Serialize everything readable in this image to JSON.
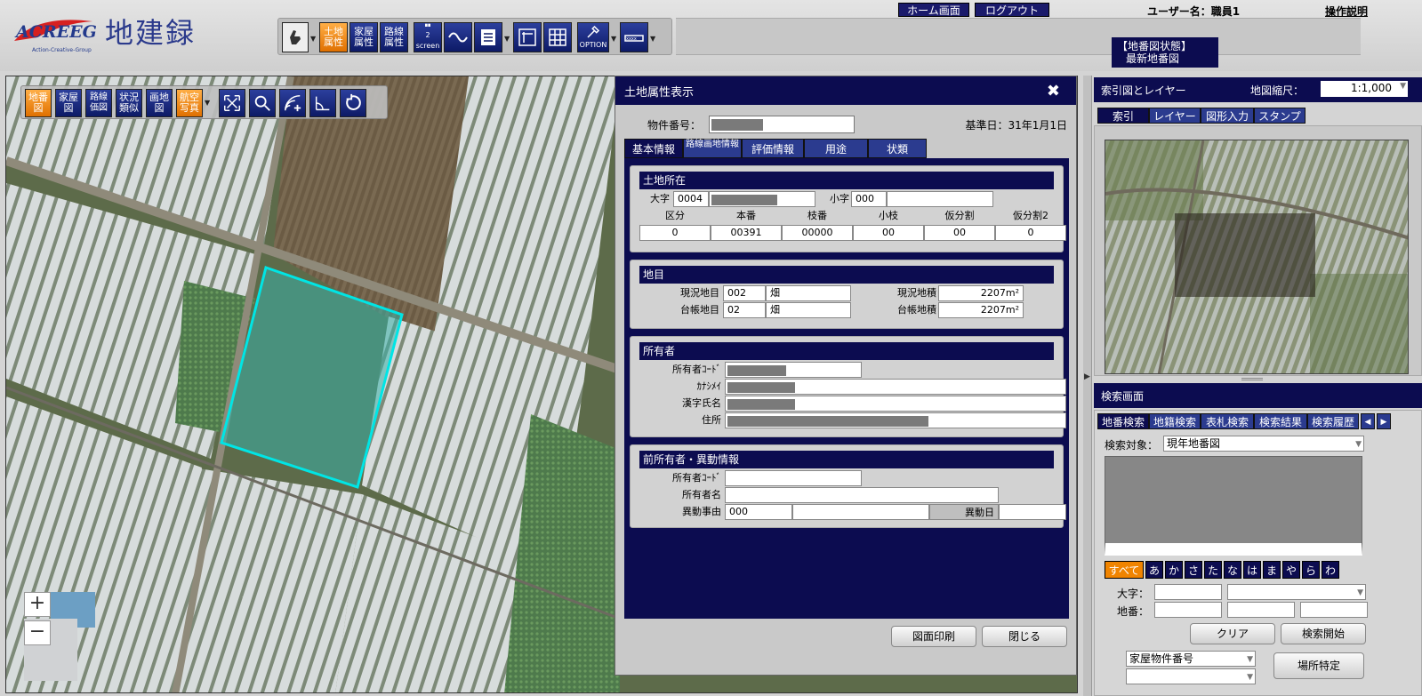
{
  "header": {
    "logo_text": "ACREEG",
    "logo_subtitle": "Action-Creative-Group",
    "app_title": "地建録",
    "home_button": "ホーム画面",
    "logout_button": "ログアウト",
    "user_label": "ユーザー名：職員1",
    "help_link": "操作説明",
    "map_status_title": "【地番図状態】",
    "map_status_value": "最新地番図"
  },
  "toolbar": {
    "buttons": [
      "土地属性",
      "家屋属性",
      "路線属性",
      "2 screen",
      "OPTION"
    ]
  },
  "map_toolbar": {
    "buttons": [
      "地番図",
      "家屋図",
      "路線価図",
      "状況類似",
      "画地図",
      "航空写真"
    ]
  },
  "zoom": {
    "in": "+",
    "out": "−"
  },
  "dialog": {
    "title": "土地属性表示",
    "close": "✖",
    "property_number_label": "物件番号：",
    "base_date": "基準日：31年1月1日",
    "tabs": [
      "基本情報",
      "路線画地情報",
      "評価情報",
      "用途",
      "状類"
    ],
    "location": {
      "header": "土地所在",
      "oaza_label": "大字",
      "oaza_code": "0004",
      "koaza_label": "小字",
      "koaza_code": "000",
      "columns": [
        "区分",
        "本番",
        "枝番",
        "小枝",
        "仮分割",
        "仮分割2"
      ],
      "values": [
        "0",
        "00391",
        "00000",
        "00",
        "00",
        "0"
      ]
    },
    "land_category": {
      "header": "地目",
      "current_label": "現況地目",
      "current_code": "002",
      "current_name": "畑",
      "ledger_label": "台帳地目",
      "ledger_code": "02",
      "ledger_name": "畑",
      "current_area_label": "現況地積",
      "current_area": "2207m²",
      "ledger_area_label": "台帳地積",
      "ledger_area": "2207m²"
    },
    "owner": {
      "header": "所有者",
      "code_label": "所有者ｺｰﾄﾞ",
      "kana_label": "ｶﾅｼﾒｲ",
      "kanji_label": "漢字氏名",
      "address_label": "住所"
    },
    "previous_owner": {
      "header": "前所有者・異動情報",
      "code_label": "所有者ｺｰﾄﾞ",
      "name_label": "所有者名",
      "reason_label": "異動事由",
      "reason_code": "000",
      "date_label": "異動日"
    },
    "print_button": "図面印刷",
    "close_button": "閉じる"
  },
  "right_panel": {
    "index_title": "索引図とレイヤー",
    "scale_label": "地図縮尺：",
    "scale_value": "1:1,000",
    "index_tabs": [
      "索引",
      "レイヤー",
      "図形入力",
      "スタンプ"
    ],
    "search_title": "検索画面",
    "search_tabs": [
      "地番検索",
      "地籍検索",
      "表札検索",
      "検索結果",
      "検索履歴"
    ],
    "search_target_label": "検索対象：",
    "search_target_value": "現年地番図",
    "kana_buttons": [
      "すべて",
      "あ",
      "か",
      "さ",
      "た",
      "な",
      "は",
      "ま",
      "や",
      "ら",
      "わ"
    ],
    "oaza_label": "大字：",
    "chiban_label": "地番：",
    "clear_button": "クリア",
    "search_button": "検索開始",
    "location_type": "家屋物件番号",
    "locate_button": "場所特定"
  },
  "colors": {
    "navy": "#0c0c50",
    "orange": "#f08400",
    "parcel_highlight": "#00e5e5"
  }
}
